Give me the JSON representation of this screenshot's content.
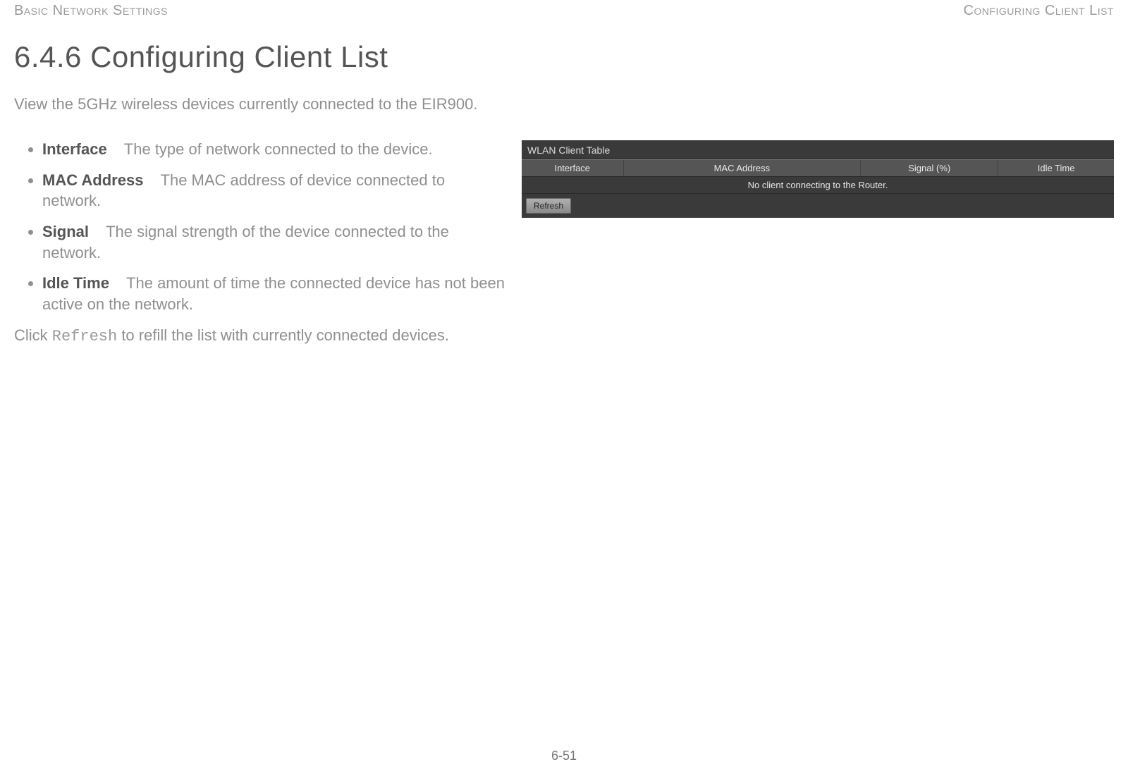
{
  "header": {
    "left": "Basic Network Settings",
    "right": "Configuring Client List"
  },
  "heading": "6.4.6 Configuring Client List",
  "lead": "View the 5GHz wireless devices currently connected to the EIR900.",
  "definitions": [
    {
      "term": "Interface",
      "desc": "The type of network connected to the device."
    },
    {
      "term": "MAC Address",
      "desc": "The MAC address of device connected to network."
    },
    {
      "term": "Signal",
      "desc": "The signal strength of the device connected to the network."
    },
    {
      "term": "Idle Time",
      "desc": "The amount of time the connected device has not been active on the network."
    }
  ],
  "click_note": {
    "prefix": "Click ",
    "code": "Refresh",
    "suffix": " to refill the list with currently connected devices."
  },
  "screenshot": {
    "title": "WLAN Client Table",
    "columns": [
      "Interface",
      "MAC Address",
      "Signal (%)",
      "Idle Time"
    ],
    "empty_message": "No client connecting to the Router.",
    "refresh_label": "Refresh"
  },
  "page_number": "6-51"
}
